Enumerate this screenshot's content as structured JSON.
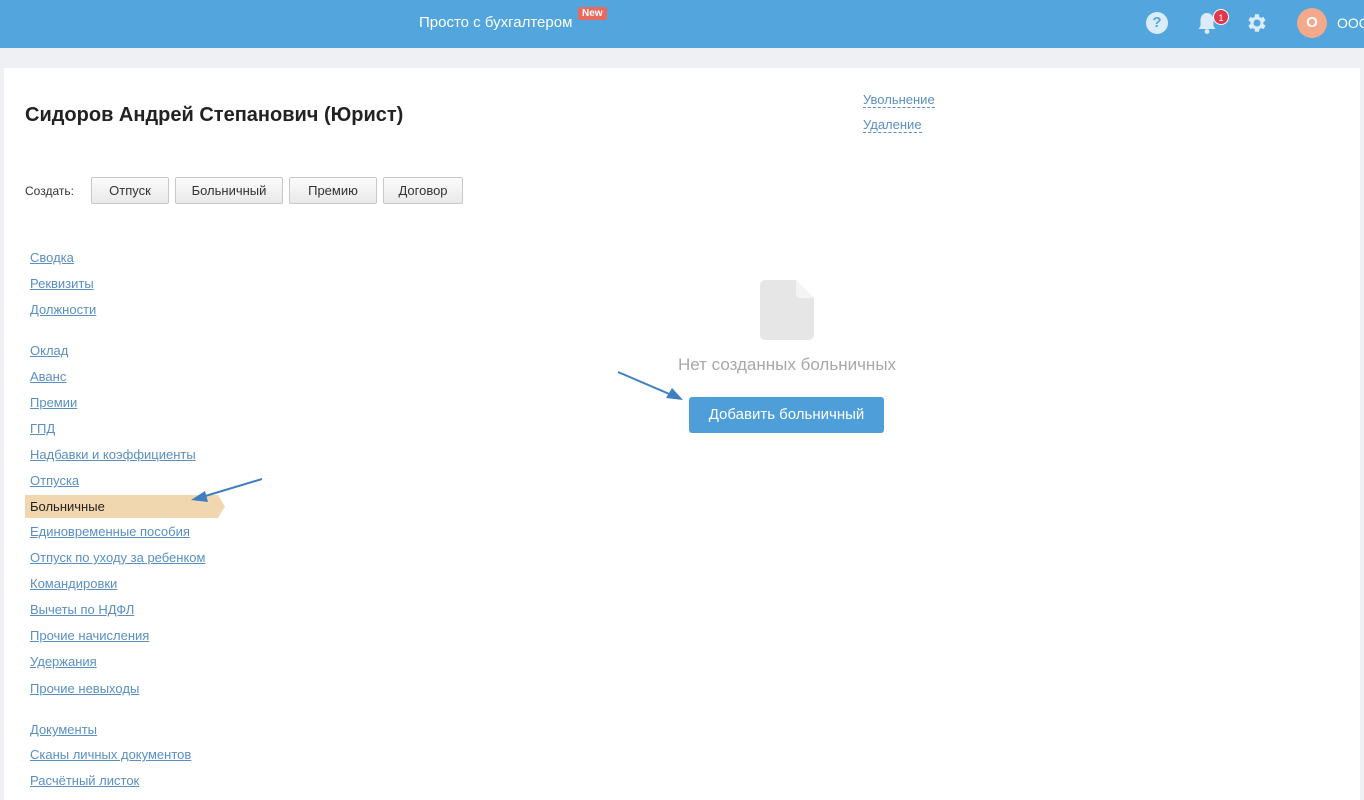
{
  "header": {
    "title": "Просто с бухгалтером",
    "new_badge": "New",
    "notification_count": "1",
    "avatar_letter": "О",
    "org_name": "ООО"
  },
  "employee": {
    "title": "Сидоров Андрей Степанович (Юрист)"
  },
  "actions": {
    "dismissal": "Увольнение",
    "delete": "Удаление"
  },
  "create": {
    "label": "Создать:",
    "buttons": [
      "Отпуск",
      "Больничный",
      "Премию",
      "Договор"
    ]
  },
  "nav": {
    "group1": [
      "Сводка",
      "Реквизиты",
      "Должности"
    ],
    "group2": [
      "Оклад",
      "Аванс",
      "Премии",
      "ГПД",
      "Надбавки и коэффициенты",
      "Отпуска"
    ],
    "active": "Больничные",
    "group3": [
      "Единовременные пособия",
      "Отпуск по уходу за ребенком",
      "Командировки",
      "Вычеты по НДФЛ",
      "Прочие начисления",
      "Удержания",
      "Прочие невыходы"
    ],
    "group4": [
      "Документы",
      "Сканы личных документов",
      "Расчётный листок"
    ]
  },
  "empty_state": {
    "text": "Нет созданных больничных",
    "button": "Добавить больничный"
  },
  "colors": {
    "topbar": "#52a5dd",
    "link": "#5a8fc2",
    "active_nav": "#f1d7af",
    "primary_button": "#4e9fd9",
    "annotation_arrow": "#3f7fc0"
  }
}
